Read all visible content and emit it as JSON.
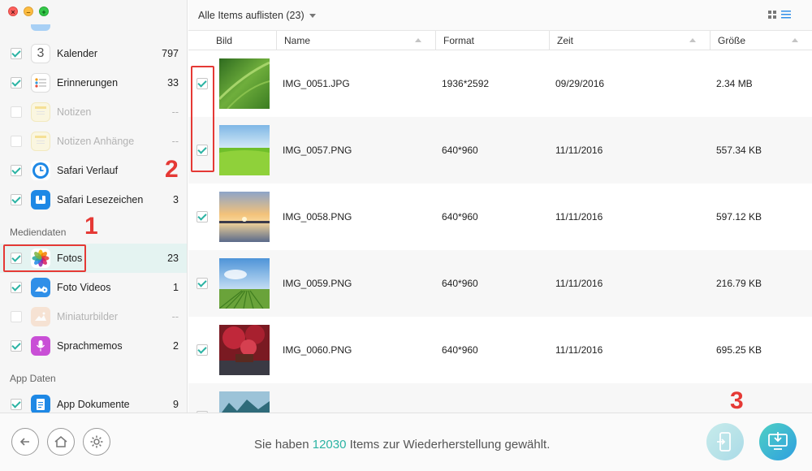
{
  "window": {
    "controls": {
      "close": "×",
      "minimize": "–",
      "maximize": "+"
    }
  },
  "sidebar": {
    "items": [
      {
        "label": "Kalender",
        "count": "797",
        "checked": true,
        "enabled": true,
        "icon": "calendar-icon",
        "icon_text": "3"
      },
      {
        "label": "Erinnerungen",
        "count": "33",
        "checked": true,
        "enabled": true,
        "icon": "reminders-icon"
      },
      {
        "label": "Notizen",
        "count": "--",
        "checked": false,
        "enabled": false,
        "icon": "notes-icon"
      },
      {
        "label": "Notizen Anhänge",
        "count": "--",
        "checked": false,
        "enabled": false,
        "icon": "notes-attachments-icon"
      },
      {
        "label": "Safari Verlauf",
        "count": "",
        "checked": true,
        "enabled": true,
        "icon": "safari-history-icon"
      },
      {
        "label": "Safari Lesezeichen",
        "count": "3",
        "checked": true,
        "enabled": true,
        "icon": "safari-bookmarks-icon"
      },
      {
        "label": "Fotos",
        "count": "23",
        "checked": true,
        "enabled": true,
        "selected": true,
        "icon": "photos-icon"
      },
      {
        "label": "Foto Videos",
        "count": "1",
        "checked": true,
        "enabled": true,
        "icon": "photo-videos-icon"
      },
      {
        "label": "Miniaturbilder",
        "count": "--",
        "checked": false,
        "enabled": false,
        "icon": "thumbnails-icon"
      },
      {
        "label": "Sprachmemos",
        "count": "2",
        "checked": true,
        "enabled": true,
        "icon": "voice-memos-icon"
      },
      {
        "label": "App Dokumente",
        "count": "9",
        "checked": true,
        "enabled": true,
        "icon": "app-documents-icon"
      }
    ],
    "sections": {
      "media": "Mediendaten",
      "app": "App Daten"
    }
  },
  "header": {
    "filter_label": "Alle Items auflisten (23)"
  },
  "table": {
    "columns": {
      "image": "Bild",
      "name": "Name",
      "format": "Format",
      "time": "Zeit",
      "size": "Größe"
    },
    "rows": [
      {
        "name": "IMG_0051.JPG",
        "format": "1936*2592",
        "time": "09/29/2016",
        "size": "2.34 MB",
        "checked": true,
        "thumb": "leaf"
      },
      {
        "name": "IMG_0057.PNG",
        "format": "640*960",
        "time": "11/11/2016",
        "size": "557.34 KB",
        "checked": true,
        "thumb": "meadow"
      },
      {
        "name": "IMG_0058.PNG",
        "format": "640*960",
        "time": "11/11/2016",
        "size": "597.12 KB",
        "checked": true,
        "thumb": "sunset"
      },
      {
        "name": "IMG_0059.PNG",
        "format": "640*960",
        "time": "11/11/2016",
        "size": "216.79 KB",
        "checked": true,
        "thumb": "field"
      },
      {
        "name": "IMG_0060.PNG",
        "format": "640*960",
        "time": "11/11/2016",
        "size": "695.25 KB",
        "checked": true,
        "thumb": "autumn"
      },
      {
        "name": "",
        "format": "",
        "time": "",
        "size": "",
        "checked": true,
        "thumb": "mountains"
      }
    ]
  },
  "annotations": {
    "one": "1",
    "two": "2",
    "three": "3"
  },
  "footer": {
    "status_prefix": "Sie haben ",
    "status_count": "12030",
    "status_suffix": " Items zur Wiederherstellung gewählt.",
    "buttons": [
      "back-icon",
      "home-icon",
      "settings-icon",
      "to-device-icon",
      "to-computer-icon"
    ]
  },
  "colors": {
    "accent": "#2bb3a3",
    "annotation": "#e53935",
    "selected_row": "#e4f3f1"
  }
}
